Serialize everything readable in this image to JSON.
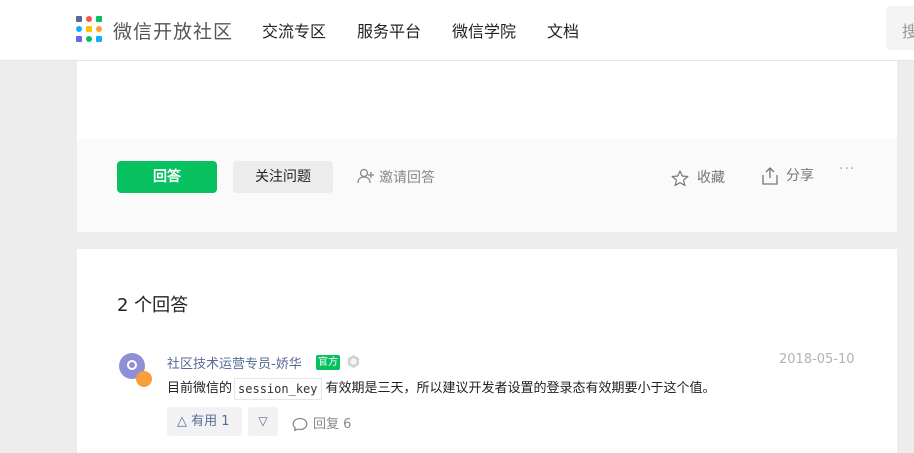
{
  "header": {
    "site_title": "微信开放社区",
    "nav": [
      "交流专区",
      "服务平台",
      "微信学院",
      "文档"
    ],
    "search_placeholder_char": "搜",
    "logo_colors": [
      "#576b95",
      "#fa5151",
      "#07c160",
      "#10aeff",
      "#ffc300",
      "#fa9d3b",
      "#6467f0",
      "#07c160",
      "#10aeff"
    ]
  },
  "question_actions": {
    "answer_label": "回答",
    "follow_label": "关注问题",
    "invite_label": "邀请回答",
    "favorite_label": "收藏",
    "share_label": "分享",
    "more_label": "···"
  },
  "answers": {
    "count_label": "2 个回答",
    "items": [
      {
        "author": "社区技术运营专员-娇华",
        "official_tag": "官方",
        "date": "2018-05-10",
        "content_prefix": "目前微信的",
        "content_code": "session_key",
        "content_suffix": "有效期是三天，所以建议开发者设置的登录态有效期要小于这个值。",
        "useful_label": "△ 有用 1",
        "useless_label": "▽",
        "reply_label": "回复 6"
      }
    ]
  },
  "colors": {
    "brand_green": "#07c160",
    "link_blue": "#576b95",
    "avatar_purple": "#8f8fd8",
    "avatar_badge": "#fa9d3b"
  }
}
